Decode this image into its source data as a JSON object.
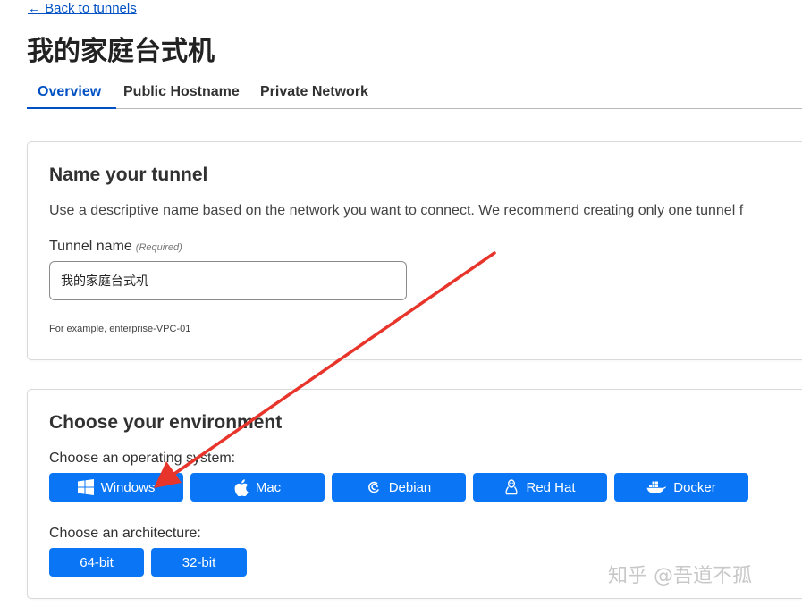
{
  "nav": {
    "back_label": "← Back to tunnels"
  },
  "page": {
    "title": "我的家庭台式机"
  },
  "tabs": [
    {
      "label": "Overview",
      "active": true
    },
    {
      "label": "Public Hostname",
      "active": false
    },
    {
      "label": "Private Network",
      "active": false
    }
  ],
  "name_card": {
    "title": "Name your tunnel",
    "description": "Use a descriptive name based on the network you want to connect. We recommend creating only one tunnel f",
    "field_label": "Tunnel name",
    "required_label": "(Required)",
    "input_value": "我的家庭台式机",
    "hint": "For example, enterprise-VPC-01"
  },
  "env_card": {
    "title": "Choose your environment",
    "os_label": "Choose an operating system:",
    "os_options": [
      {
        "label": "Windows",
        "icon": "windows-icon"
      },
      {
        "label": "Mac",
        "icon": "apple-icon"
      },
      {
        "label": "Debian",
        "icon": "debian-icon"
      },
      {
        "label": "Red Hat",
        "icon": "linux-icon"
      },
      {
        "label": "Docker",
        "icon": "docker-icon"
      }
    ],
    "arch_label": "Choose an architecture:",
    "arch_options": [
      {
        "label": "64-bit"
      },
      {
        "label": "32-bit"
      }
    ]
  },
  "watermark": "知乎 @吾道不孤",
  "colors": {
    "accent": "#0051c3",
    "button": "#0a76f6",
    "annotation_arrow": "#e8352b"
  }
}
